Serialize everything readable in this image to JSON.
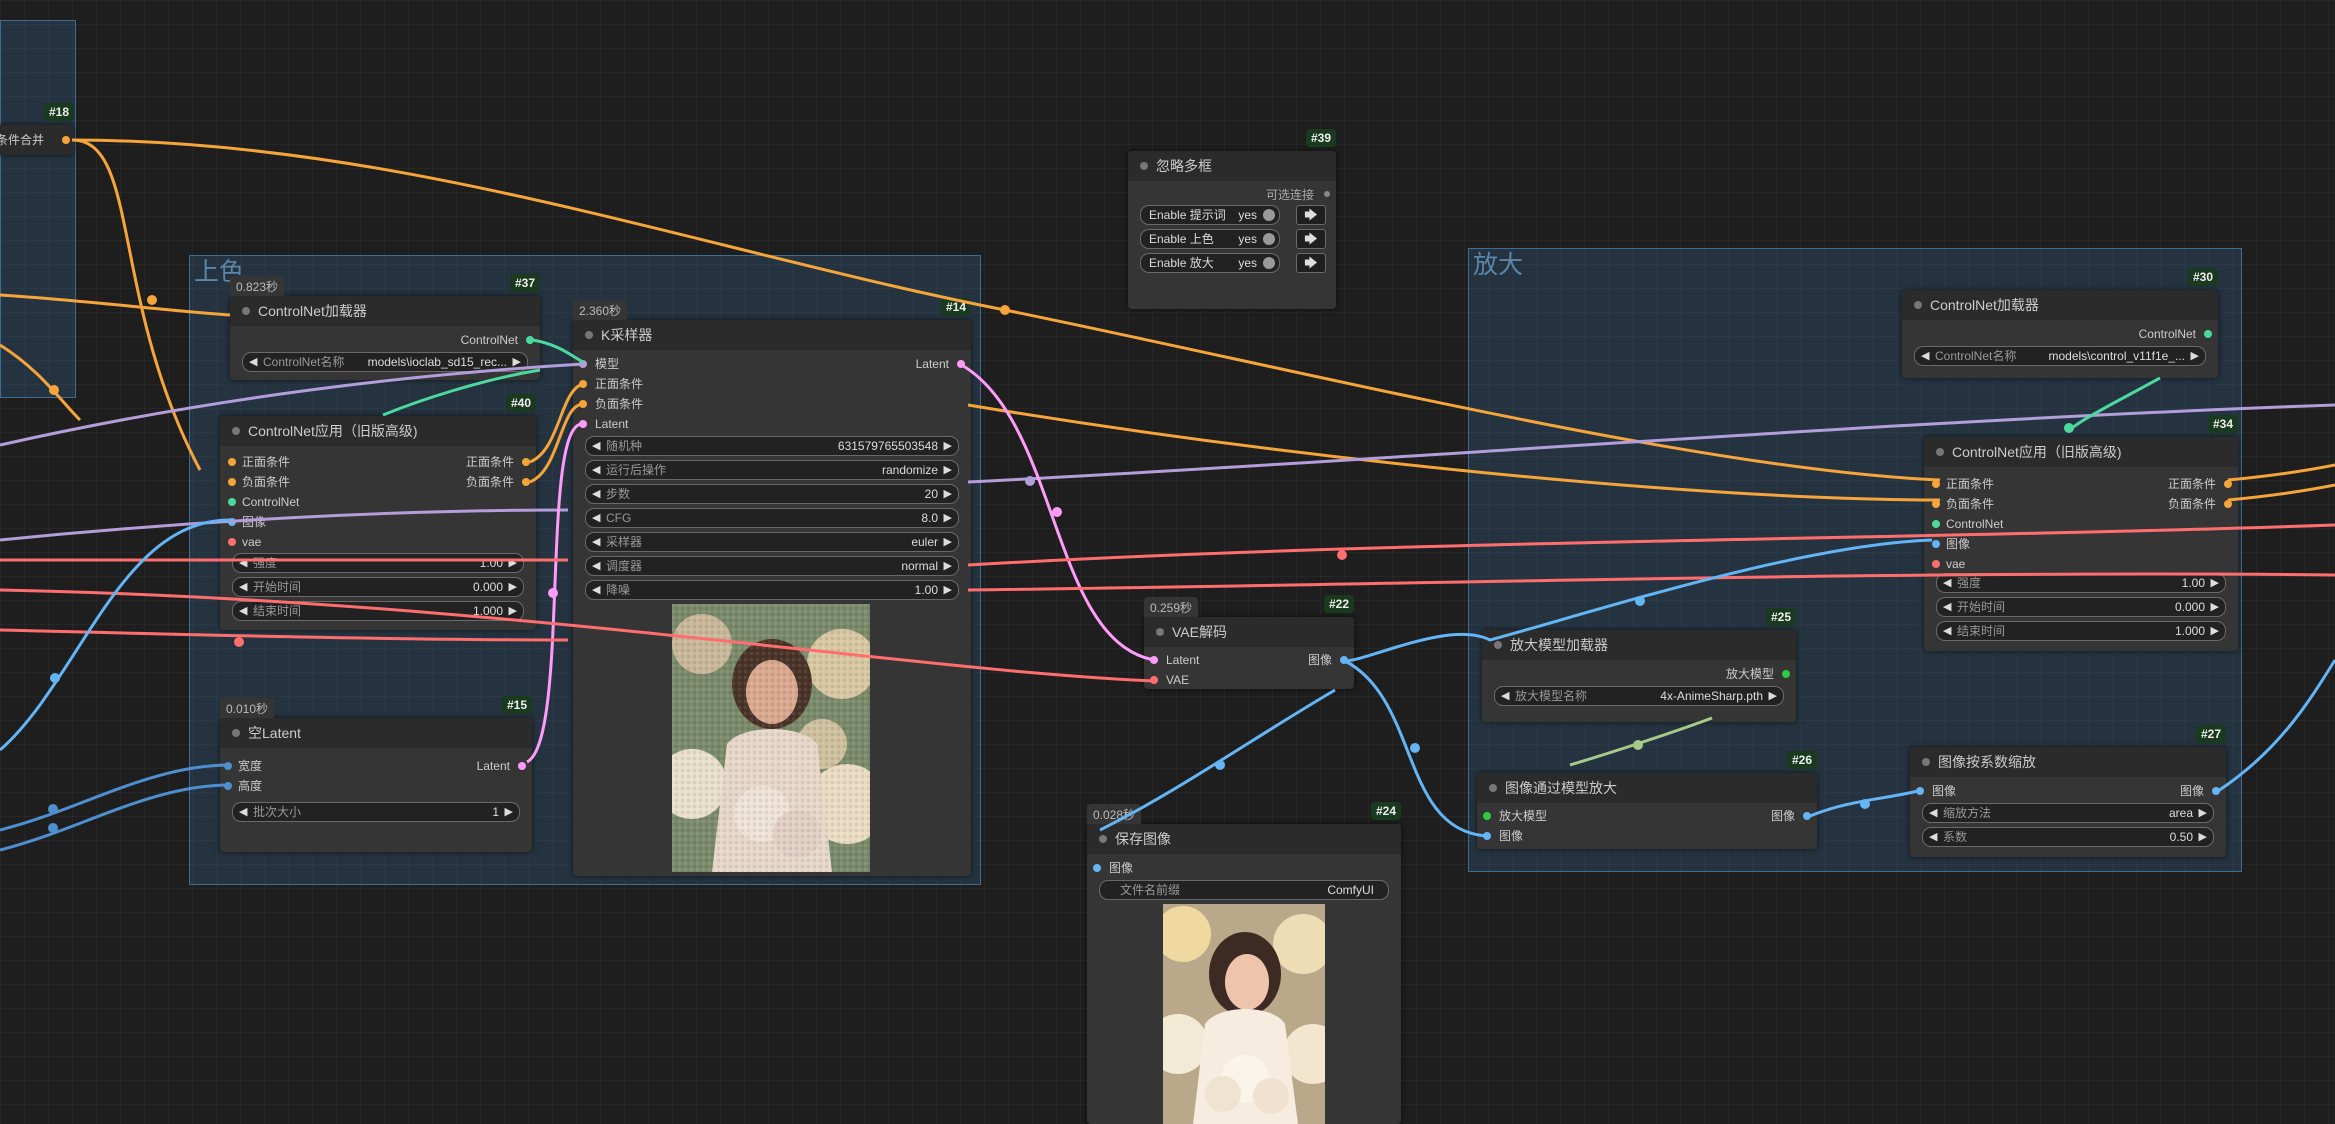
{
  "colors": {
    "conditioning": "#f5a53a",
    "model": "#b39ddb",
    "controlnet": "#4cd9a0",
    "image": "#64b5f6",
    "vae": "#ff6e6e",
    "latent": "#ff9cf9",
    "upscale_model": "#2ecc40",
    "canvas": "#1e1e1e",
    "node_bg": "#353535",
    "group": "#3d6d92"
  },
  "groups": {
    "left_group": {
      "title": ""
    },
    "coloring": {
      "title": "上色"
    },
    "upscale": {
      "title": "放大"
    }
  },
  "nodes": {
    "n18": {
      "id": "#18",
      "partial_label": "条件合并"
    },
    "n37": {
      "id": "#37",
      "timing": "0.823秒",
      "title": "ControlNet加载器",
      "output": "ControlNet",
      "widget_label": "ControlNet名称",
      "widget_value": "models\\ioclab_sd15_rec..."
    },
    "n40": {
      "id": "#40",
      "title": "ControlNet应用（旧版高级)",
      "inputs": [
        "正面条件",
        "负面条件",
        "ControlNet",
        "图像",
        "vae"
      ],
      "outputs": [
        "正面条件",
        "负面条件"
      ],
      "widgets": [
        {
          "label": "强度",
          "value": "1.00"
        },
        {
          "label": "开始时间",
          "value": "0.000"
        },
        {
          "label": "结束时间",
          "value": "1.000"
        }
      ]
    },
    "n15": {
      "id": "#15",
      "timing": "0.010秒",
      "title": "空Latent",
      "inputs": [
        "宽度",
        "高度"
      ],
      "output": "Latent",
      "widgets": [
        {
          "label": "批次大小",
          "value": "1"
        }
      ]
    },
    "n14": {
      "id": "#14",
      "timing": "2.360秒",
      "title": "K采样器",
      "inputs": [
        "模型",
        "正面条件",
        "负面条件",
        "Latent"
      ],
      "output": "Latent",
      "widgets": [
        {
          "label": "随机种",
          "value": "631579765503548"
        },
        {
          "label": "运行后操作",
          "value": "randomize"
        },
        {
          "label": "步数",
          "value": "20"
        },
        {
          "label": "CFG",
          "value": "8.0"
        },
        {
          "label": "采样器",
          "value": "euler"
        },
        {
          "label": "调度器",
          "value": "normal"
        },
        {
          "label": "降噪",
          "value": "1.00"
        }
      ]
    },
    "n39": {
      "id": "#39",
      "title": "忽略多框",
      "output": "可选连接",
      "toggles": [
        {
          "label": "Enable 提示词",
          "value": "yes"
        },
        {
          "label": "Enable 上色",
          "value": "yes"
        },
        {
          "label": "Enable 放大",
          "value": "yes"
        }
      ],
      "arrow": "🡆"
    },
    "n22": {
      "id": "#22",
      "timing": "0.259秒",
      "title": "VAE解码",
      "inputs": [
        "Latent",
        "VAE"
      ],
      "output": "图像"
    },
    "n24": {
      "id": "#24",
      "timing": "0.028秒",
      "title": "保存图像",
      "inputs": [
        "图像"
      ],
      "widgets": [
        {
          "label": "文件名前缀",
          "value": "ComfyUI"
        }
      ]
    },
    "n30": {
      "id": "#30",
      "title": "ControlNet加载器",
      "output": "ControlNet",
      "widget_label": "ControlNet名称",
      "widget_value": "models\\control_v11f1e_..."
    },
    "n34": {
      "id": "#34",
      "title": "ControlNet应用（旧版高级)",
      "inputs": [
        "正面条件",
        "负面条件",
        "ControlNet",
        "图像",
        "vae"
      ],
      "outputs": [
        "正面条件",
        "负面条件"
      ],
      "widgets": [
        {
          "label": "强度",
          "value": "1.00"
        },
        {
          "label": "开始时间",
          "value": "0.000"
        },
        {
          "label": "结束时间",
          "value": "1.000"
        }
      ]
    },
    "n25": {
      "id": "#25",
      "title": "放大模型加载器",
      "output": "放大模型",
      "widgets": [
        {
          "label": "放大模型名称",
          "value": "4x-AnimeSharp.pth"
        }
      ]
    },
    "n26": {
      "id": "#26",
      "title": "图像通过模型放大",
      "inputs": [
        "放大模型",
        "图像"
      ],
      "output": "图像"
    },
    "n27": {
      "id": "#27",
      "title": "图像按系数缩放",
      "inputs": [
        "图像"
      ],
      "output": "图像",
      "widgets": [
        {
          "label": "缩放方法",
          "value": "area"
        },
        {
          "label": "系数",
          "value": "0.50"
        }
      ]
    }
  }
}
